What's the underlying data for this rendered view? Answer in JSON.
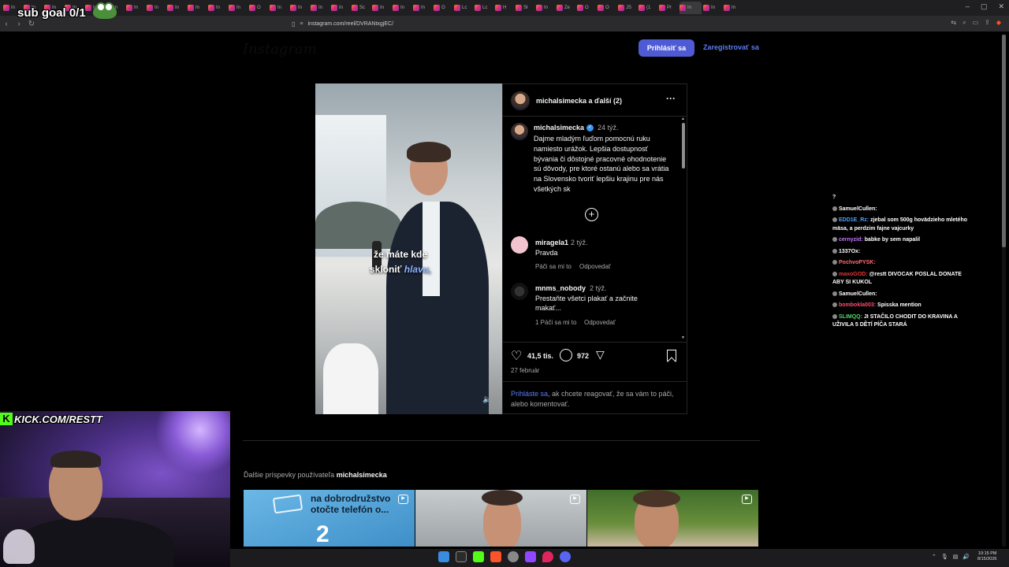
{
  "browser": {
    "url": "instagram.com/reel/DVRANtxgjEC/",
    "tab_labels": [
      "In",
      "In",
      "In",
      "In",
      "In",
      "In",
      "In",
      "In",
      "In",
      "In",
      "In",
      "In",
      "O",
      "In",
      "In",
      "In",
      "In",
      "Sc",
      "In",
      "In",
      "In",
      "O",
      "Lc",
      "Lc",
      "H",
      "Sł",
      "In",
      "Ze",
      "O",
      "O",
      "JS",
      "(1",
      "Pr",
      "In",
      "In",
      "In"
    ]
  },
  "instagram": {
    "logo": "Instagram",
    "login_button": "Prihlásiť sa",
    "register_button": "Zaregistrovať sa",
    "post": {
      "header_title": "michalsimecka a ďalší (2)",
      "video_caption_line1": "že máte kde",
      "video_caption_line2_a": "skloniť ",
      "video_caption_line2_b": "hlavu,",
      "caption_user": "michalsimecka",
      "caption_time": "24 týž.",
      "caption_text": "Dajme mladým ľuďom pomocnú ruku namiesto urážok. Lepšia dostupnosť bývania či dôstojné pracovné ohodnotenie sú dôvody, pre ktoré ostanú alebo sa vrátia na Slovensko tvoriť lepšiu krajinu pre nás všetkých sk",
      "comments": [
        {
          "user": "miragela1",
          "time": "2 týž.",
          "text": "Pravda",
          "meta_like": "Páči sa mi to",
          "meta_reply": "Odpovedať"
        },
        {
          "user": "mnms_nobody",
          "time": "2 týž.",
          "text": "Prestaňte všetci plakať a začnite makať...",
          "meta_like": "1 Páči sa mi to",
          "meta_reply": "Odpovedať"
        }
      ],
      "likes": "41,5 tis.",
      "comments_count": "972",
      "date": "27 február",
      "login_prompt_link": "Prihláste sa",
      "login_prompt_rest": ", ak chcete reagovať, že sa vám to páči, alebo komentovať."
    },
    "more_posts_prefix": "Ďalšie príspevky používateľa ",
    "more_posts_user": "michalsimecka",
    "thumb1_text": "na dobrodružstvo otočte telefón o...",
    "thumb1_big": "2"
  },
  "stream": {
    "sub_goal": "sub goal 0/1",
    "kick_url": "KICK.COM/RESTT",
    "chat_header": "?",
    "chat": [
      {
        "user": "SamuelCullen:",
        "msg": "",
        "color": "#ffffff"
      },
      {
        "user": "EDD1E_Rz:",
        "msg": "zjebal som 500g hovädzieho mletého mäsa, a perdzim fajne vajcurky",
        "color": "#4fa3ff"
      },
      {
        "user": "cernyzid:",
        "msg": "babke by sem napalil",
        "color": "#c678ff"
      },
      {
        "user": "1337Ox:",
        "msg": "",
        "color": "#ffffff"
      },
      {
        "user": "PochvoPYSK:",
        "msg": "",
        "color": "#ff6b6b"
      },
      {
        "user": "maxoGOD:",
        "msg": "@restt DIVOCAK POSLAL DONATE ABY SI KUKOL",
        "color": "#e53935"
      },
      {
        "user": "SamuelCullen:",
        "msg": "",
        "color": "#ffffff"
      },
      {
        "user": "bombokla003:",
        "msg": "Spisska mention",
        "color": "#ff4d6d"
      },
      {
        "user": "SLIMQQ:",
        "msg": "JI STAČILO CHODIT DO KRAVINA A UŽIVILA 5 DĚTÍ PÍČA STARÁ",
        "color": "#5ad16a"
      }
    ]
  },
  "taskbar": {
    "time": "10:15 PM",
    "date": "8/15/2026"
  },
  "colors": {
    "accent": "#4f5bd5",
    "link": "#5b7cf7",
    "kick_green": "#53fc18"
  }
}
